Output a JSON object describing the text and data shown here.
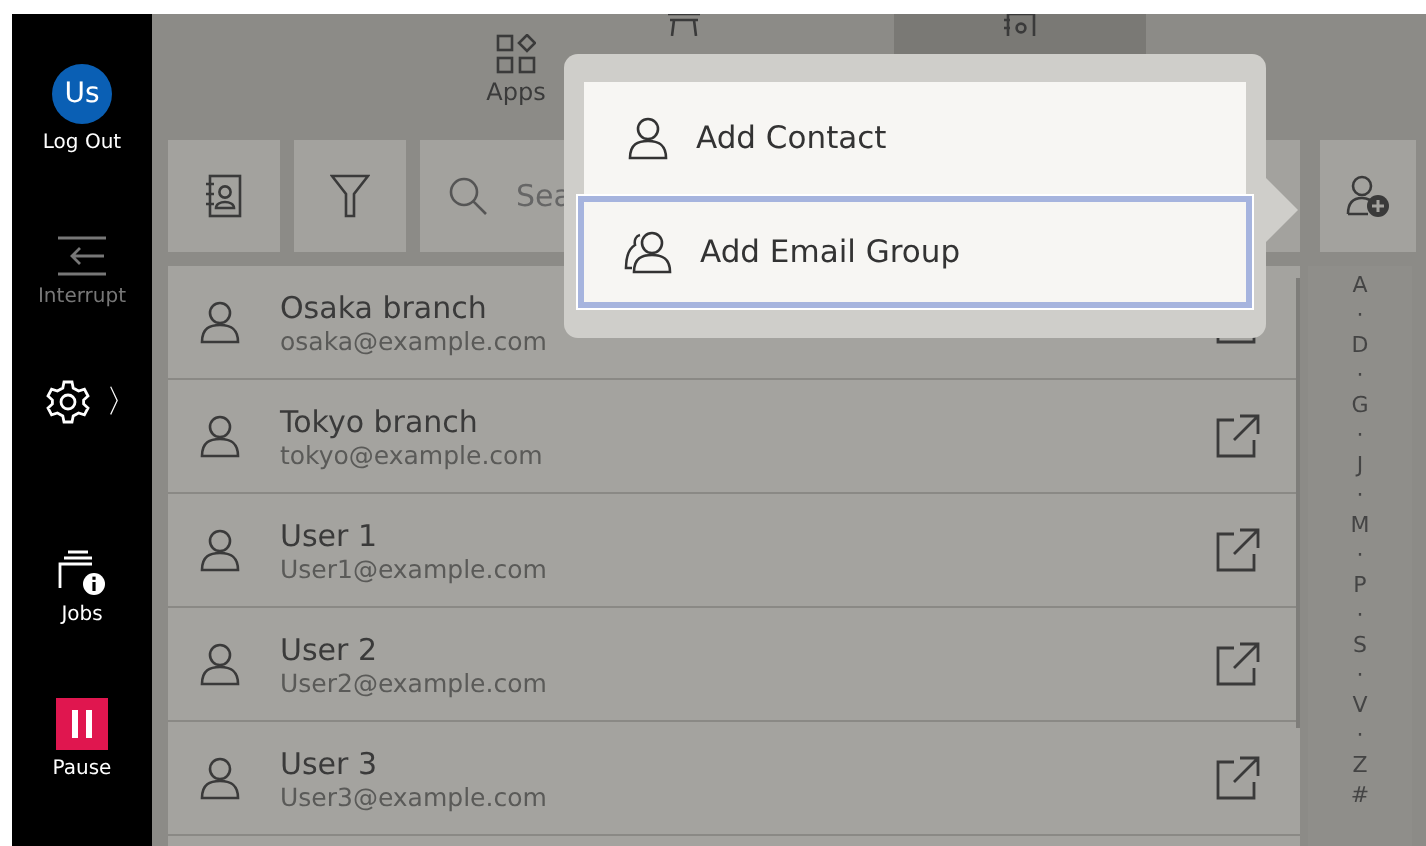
{
  "sidebar": {
    "avatar": "Us",
    "items": [
      {
        "kind": "logout",
        "label": "Log Out",
        "disabled": false
      },
      {
        "kind": "interrupt",
        "label": "Interrupt",
        "disabled": true
      },
      {
        "kind": "settings",
        "label": "〉",
        "disabled": false
      },
      {
        "kind": "jobs",
        "label": "Jobs",
        "disabled": false
      },
      {
        "kind": "pause",
        "label": "Pause",
        "disabled": false
      }
    ]
  },
  "tabs": [
    {
      "kind": "apps",
      "label": "Apps",
      "selected": false
    },
    {
      "kind": "stool",
      "selected": false
    },
    {
      "kind": "book",
      "selected": true
    }
  ],
  "search": {
    "placeholder": "Sea"
  },
  "contacts": [
    {
      "name": "Osaka branch",
      "email": "osaka@example.com"
    },
    {
      "name": "Tokyo branch",
      "email": "tokyo@example.com"
    },
    {
      "name": "User 1",
      "email": "User1@example.com"
    },
    {
      "name": "User 2",
      "email": "User2@example.com"
    },
    {
      "name": "User 3",
      "email": "User3@example.com"
    }
  ],
  "index": [
    "A",
    "·",
    "D",
    "·",
    "G",
    "·",
    "J",
    "·",
    "M",
    "·",
    "P",
    "·",
    "S",
    "·",
    "V",
    "·",
    "Z",
    "#"
  ],
  "menu": [
    {
      "kind": "contact",
      "label": "Add Contact",
      "selected": false
    },
    {
      "kind": "group",
      "label": "Add Email Group",
      "selected": true
    }
  ]
}
